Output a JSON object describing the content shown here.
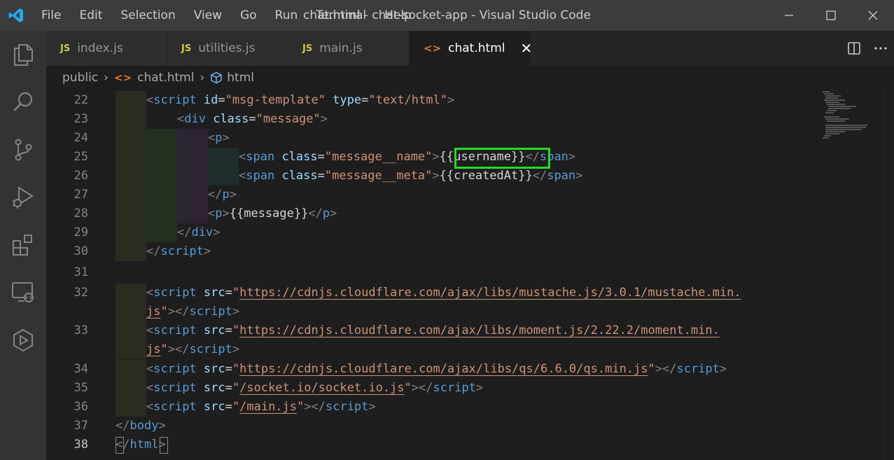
{
  "window": {
    "title": "chat.html - chat-socket-app - Visual Studio Code",
    "menu": [
      "File",
      "Edit",
      "Selection",
      "View",
      "Go",
      "Run",
      "Terminal",
      "Help"
    ]
  },
  "tabs": [
    {
      "icon": "JS",
      "label": "index.js",
      "active": false
    },
    {
      "icon": "JS",
      "label": "utilities.js",
      "active": false
    },
    {
      "icon": "JS",
      "label": "main.js",
      "active": false
    },
    {
      "icon": "<>",
      "label": "chat.html",
      "active": true
    }
  ],
  "tab_close": "✕",
  "breadcrumb": {
    "folder": "public",
    "file": "chat.html",
    "symbol": "html"
  },
  "editor": {
    "current_line": "38",
    "highlight_color": "#22dd22",
    "lines": [
      {
        "n": "22"
      },
      {
        "n": "23"
      },
      {
        "n": "24"
      },
      {
        "n": "25"
      },
      {
        "n": "26"
      },
      {
        "n": "27"
      },
      {
        "n": "28"
      },
      {
        "n": "29"
      },
      {
        "n": "30"
      },
      {
        "n": "31"
      },
      {
        "n": "32"
      },
      {
        "n": "33"
      },
      {
        "n": "34"
      },
      {
        "n": "35"
      },
      {
        "n": "36"
      },
      {
        "n": "37"
      },
      {
        "n": "38"
      }
    ],
    "code": {
      "l22": {
        "t1": "<",
        "t2": "script",
        "a1": " id",
        "e1": "=",
        "s1": "\"msg-template\"",
        "a2": " type",
        "e2": "=",
        "s2": "\"text/html\"",
        "t3": ">"
      },
      "l23": {
        "t1": "<",
        "t2": "div",
        "a1": " class",
        "e1": "=",
        "s1": "\"message\"",
        "t3": ">"
      },
      "l24": {
        "t1": "<",
        "t2": "p",
        "t3": ">"
      },
      "l25": {
        "t1": "<",
        "t2": "span",
        "a1": " class",
        "e1": "=",
        "s1": "\"message__name\"",
        "t3": ">",
        "txt": "{{username}}",
        "t4": "</",
        "t5": "span",
        "t6": ">"
      },
      "l26": {
        "t1": "<",
        "t2": "span",
        "a1": " class",
        "e1": "=",
        "s1": "\"message__meta\"",
        "t3": ">",
        "txt": "{{createdAt}}",
        "t4": "</",
        "t5": "span",
        "t6": ">"
      },
      "l27": {
        "t1": "</",
        "t2": "p",
        "t3": ">"
      },
      "l28": {
        "t1": "<",
        "t2": "p",
        "t3": ">",
        "txt": "{{message}}",
        "t4": "</",
        "t5": "p",
        "t6": ">"
      },
      "l29": {
        "t1": "</",
        "t2": "div",
        "t3": ">"
      },
      "l30": {
        "t1": "</",
        "t2": "script",
        "t3": ">"
      },
      "l32": {
        "t1": "<",
        "t2": "script",
        "a1": " src",
        "e1": "=",
        "q1": "\"",
        "u1": "https://cdnjs.cloudflare.com/ajax/libs/mustache.js/3.0.1/mustache.min.",
        "u2": "js",
        "q2": "\"",
        "t3": "></",
        "t4": "script",
        "t5": ">"
      },
      "l33": {
        "t1": "<",
        "t2": "script",
        "a1": " src",
        "e1": "=",
        "q1": "\"",
        "u1": "https://cdnjs.cloudflare.com/ajax/libs/moment.js/2.22.2/moment.min.",
        "u2": "js",
        "q2": "\"",
        "t3": "></",
        "t4": "script",
        "t5": ">"
      },
      "l34": {
        "t1": "<",
        "t2": "script",
        "a1": " src",
        "e1": "=",
        "q1": "\"",
        "u1": "https://cdnjs.cloudflare.com/ajax/libs/qs/6.6.0/qs.min.js",
        "q2": "\"",
        "t3": "></",
        "t4": "script",
        "t5": ">"
      },
      "l35": {
        "t1": "<",
        "t2": "script",
        "a1": " src",
        "e1": "=",
        "q1": "\"",
        "u1": "/socket.io/socket.io.js",
        "q2": "\"",
        "t3": "></",
        "t4": "script",
        "t5": ">"
      },
      "l36": {
        "t1": "<",
        "t2": "script",
        "a1": " src",
        "e1": "=",
        "q1": "\"",
        "u1": "/main.js",
        "q2": "\"",
        "t3": "></",
        "t4": "script",
        "t5": ">"
      },
      "l37": {
        "t1": "</",
        "t2": "body",
        "t3": ">"
      },
      "l38": {
        "t1": "</",
        "t2": "html",
        "t3": ">"
      }
    }
  },
  "icons": {
    "explorer": "files-icon",
    "search": "search-icon",
    "scm": "source-control-icon",
    "debug": "run-debug-icon",
    "extensions": "extensions-icon",
    "remote": "remote-explorer-icon",
    "live": "live-share-icon"
  }
}
